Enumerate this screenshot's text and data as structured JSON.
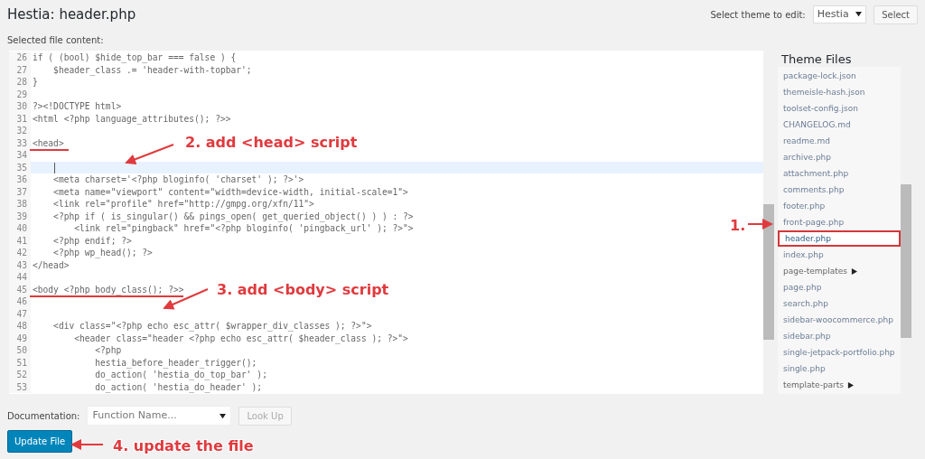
{
  "page": {
    "title": "Hestia: header.php",
    "content_label": "Selected file content:"
  },
  "theme_picker": {
    "label": "Select theme to edit:",
    "value": "Hestia",
    "button": "Select"
  },
  "editor": {
    "lines": [
      {
        "number": "26",
        "code": "if ( (bool) $hide_top_bar === false ) {",
        "active": false
      },
      {
        "number": "27",
        "code": "    $header_class .= 'header-with-topbar';",
        "active": false
      },
      {
        "number": "28",
        "code": "}",
        "active": false
      },
      {
        "number": "29",
        "active": false
      },
      {
        "number": "30",
        "code": "?><!DOCTYPE html>",
        "active": false
      },
      {
        "number": "31",
        "code": "<html <?php language_attributes(); ?>>",
        "active": false
      },
      {
        "number": "32",
        "active": false
      },
      {
        "number": "33",
        "code": "<head>",
        "active": false
      },
      {
        "number": "34",
        "active": false
      },
      {
        "number": "35",
        "active": true
      },
      {
        "number": "36",
        "code": "    <meta charset='<?php bloginfo( 'charset' ); ?>'>",
        "active": false
      },
      {
        "number": "37",
        "code": "    <meta name=\"viewport\" content=\"width=device-width, initial-scale=1\">",
        "active": false
      },
      {
        "number": "38",
        "code": "    <link rel=\"profile\" href=\"http://gmpg.org/xfn/11\">",
        "active": false
      },
      {
        "number": "39",
        "code": "    <?php if ( is_singular() && pings_open( get_queried_object() ) ) : ?>",
        "active": false
      },
      {
        "number": "40",
        "code": "        <link rel=\"pingback\" href=\"<?php bloginfo( 'pingback_url' ); ?>\">",
        "active": false
      },
      {
        "number": "41",
        "code": "    <?php endif; ?>",
        "active": false
      },
      {
        "number": "42",
        "code": "    <?php wp_head(); ?>",
        "active": false
      },
      {
        "number": "43",
        "code": "</head>",
        "active": false
      },
      {
        "number": "44",
        "active": false
      },
      {
        "number": "45",
        "code": "<body <?php body_class(); ?>>",
        "active": false
      },
      {
        "number": "46",
        "active": false
      },
      {
        "number": "47",
        "active": false
      },
      {
        "number": "48",
        "code": "    <div class=\"<?php echo esc_attr( $wrapper_div_classes ); ?>\">",
        "active": false
      },
      {
        "number": "49",
        "code": "        <header class=\"header <?php echo esc_attr( $header_class ); ?>\">",
        "active": false
      },
      {
        "number": "50",
        "code": "            <?php",
        "active": false
      },
      {
        "number": "51",
        "code": "            hestia_before_header_trigger();",
        "active": false
      },
      {
        "number": "52",
        "code": "            do_action( 'hestia_do_top_bar' );",
        "active": false
      },
      {
        "number": "53",
        "code": "            do_action( 'hestia_do_header' );",
        "active": false
      }
    ]
  },
  "theme_files": {
    "title": "Theme Files",
    "items": [
      {
        "label": "package-lock.json",
        "kind": "file",
        "selected": false
      },
      {
        "label": "themeisle-hash.json",
        "kind": "file",
        "selected": false
      },
      {
        "label": "toolset-config.json",
        "kind": "file",
        "selected": false
      },
      {
        "label": "CHANGELOG.md",
        "kind": "file",
        "selected": false
      },
      {
        "label": "readme.md",
        "kind": "file",
        "selected": false
      },
      {
        "label": "archive.php",
        "kind": "file",
        "selected": false
      },
      {
        "label": "attachment.php",
        "kind": "file",
        "selected": false
      },
      {
        "label": "comments.php",
        "kind": "file",
        "selected": false
      },
      {
        "label": "footer.php",
        "kind": "file",
        "selected": false
      },
      {
        "label": "front-page.php",
        "kind": "file",
        "selected": false
      },
      {
        "label": "header.php",
        "kind": "file",
        "selected": true
      },
      {
        "label": "index.php",
        "kind": "file",
        "selected": false
      },
      {
        "label": "page-templates",
        "kind": "folder",
        "selected": false
      },
      {
        "label": "page.php",
        "kind": "file",
        "selected": false
      },
      {
        "label": "search.php",
        "kind": "file",
        "selected": false
      },
      {
        "label": "sidebar-woocommerce.php",
        "kind": "file",
        "selected": false
      },
      {
        "label": "sidebar.php",
        "kind": "file",
        "selected": false
      },
      {
        "label": "single-jetpack-portfolio.php",
        "kind": "file",
        "selected": false
      },
      {
        "label": "single.php",
        "kind": "file",
        "selected": false
      },
      {
        "label": "template-parts",
        "kind": "folder",
        "selected": false
      }
    ]
  },
  "documentation": {
    "label": "Documentation:",
    "placeholder": "Function Name...",
    "button": "Look Up"
  },
  "update_button": "Update File",
  "annotations": [
    "1.",
    "2. add <head> script",
    "3. add <body> script",
    "4. update the file"
  ]
}
